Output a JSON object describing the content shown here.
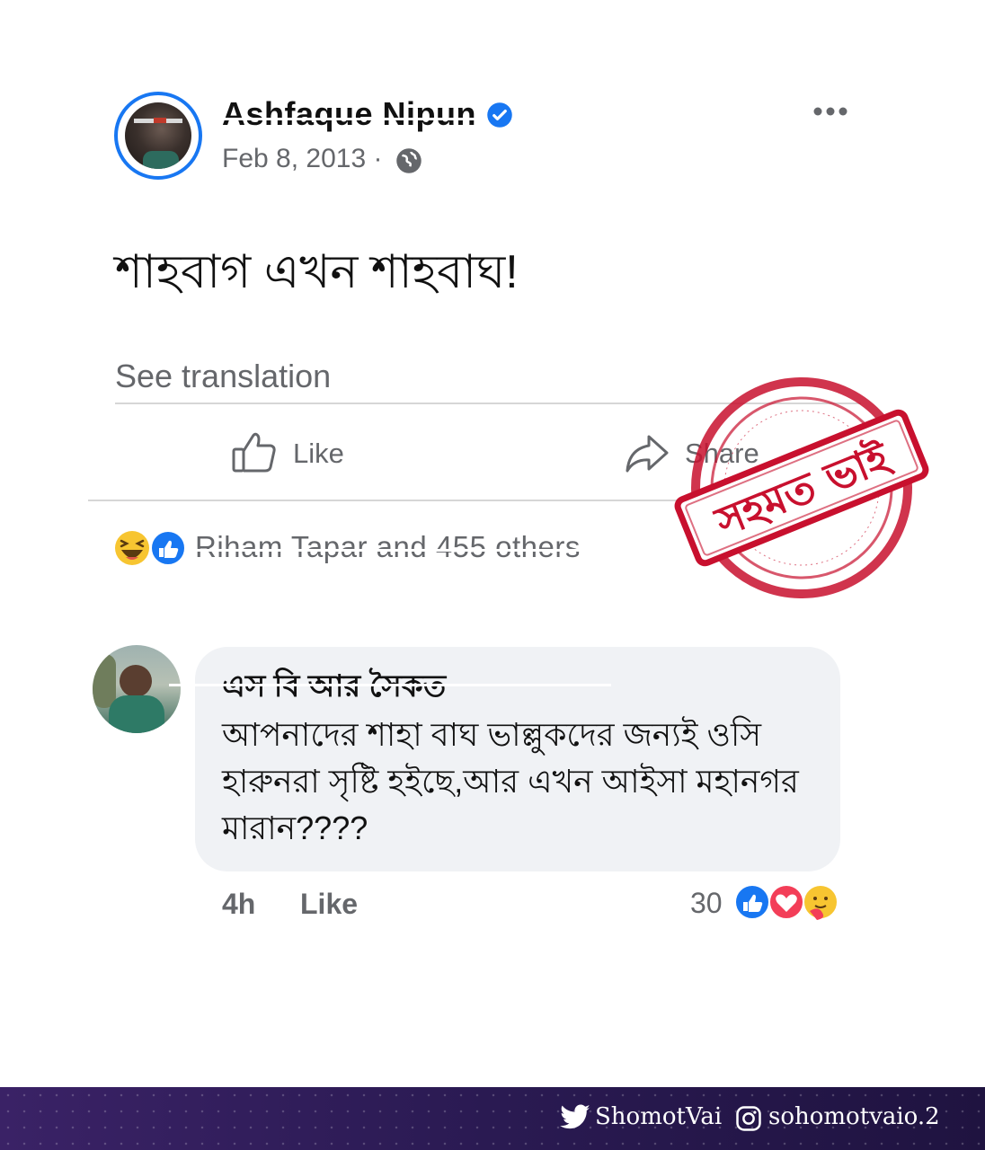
{
  "post": {
    "author": "Ashfaque Nipun",
    "date": "Feb 8, 2013 ·",
    "text": "শাহবাগ এখন শাহবাঘ!",
    "see_translation": "See translation",
    "actions": {
      "like": "Like",
      "share": "Share"
    },
    "reactions_text": "Riham Tapar and 455 others"
  },
  "comment": {
    "author": "এস বি আর সৈকত",
    "text": "আপনাদের শাহা বাঘ ভাল্লুকদের জন্যই ওসি হারুনরা সৃষ্টি হইছে,আর এখন আইসা মহানগর মারান????",
    "time": "4h",
    "like": "Like",
    "reaction_count": "30"
  },
  "stamp": {
    "text": "সহমত ভাই",
    "color": "#c8102e"
  },
  "footer": {
    "twitter": "ShomotVai",
    "instagram": "sohomotvaio.2"
  },
  "colors": {
    "accent": "#1877f2",
    "secondary_text": "#65676b",
    "bubble": "#f0f2f5"
  },
  "icons": [
    "verified-icon",
    "globe-icon",
    "more-icon",
    "like-icon",
    "share-icon",
    "haha-icon",
    "thumbs-up-icon",
    "love-icon",
    "care-icon",
    "twitter-icon",
    "instagram-icon"
  ]
}
